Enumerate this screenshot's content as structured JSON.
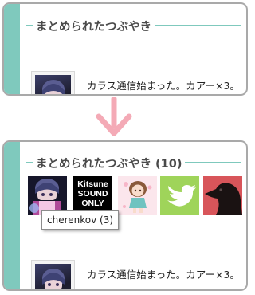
{
  "before": {
    "title": "まとめられたつぶやき",
    "entry_text": "カラス通信始まった。カアー×3。"
  },
  "after": {
    "title": "まとめられたつぶやき (10)",
    "entry_text": "カラス通信始まった。カアー×3。",
    "avatars": [
      {
        "icon": "anime-girl-avatar"
      },
      {
        "icon": "kitsune-sound-only-avatar",
        "lines": [
          "Kitsune",
          "SOUND",
          "ONLY"
        ]
      },
      {
        "icon": "chibi-girl-avatar"
      },
      {
        "icon": "twitter-bird-avatar"
      },
      {
        "icon": "crow-avatar"
      }
    ],
    "tooltip": "cherenkov (3)"
  },
  "colors": {
    "accent": "#7fc9bd",
    "arrow": "#f4aab6",
    "border": "#a9a9a9",
    "twitter_green": "#9fd45a",
    "crow_bg": "#d8555a"
  }
}
